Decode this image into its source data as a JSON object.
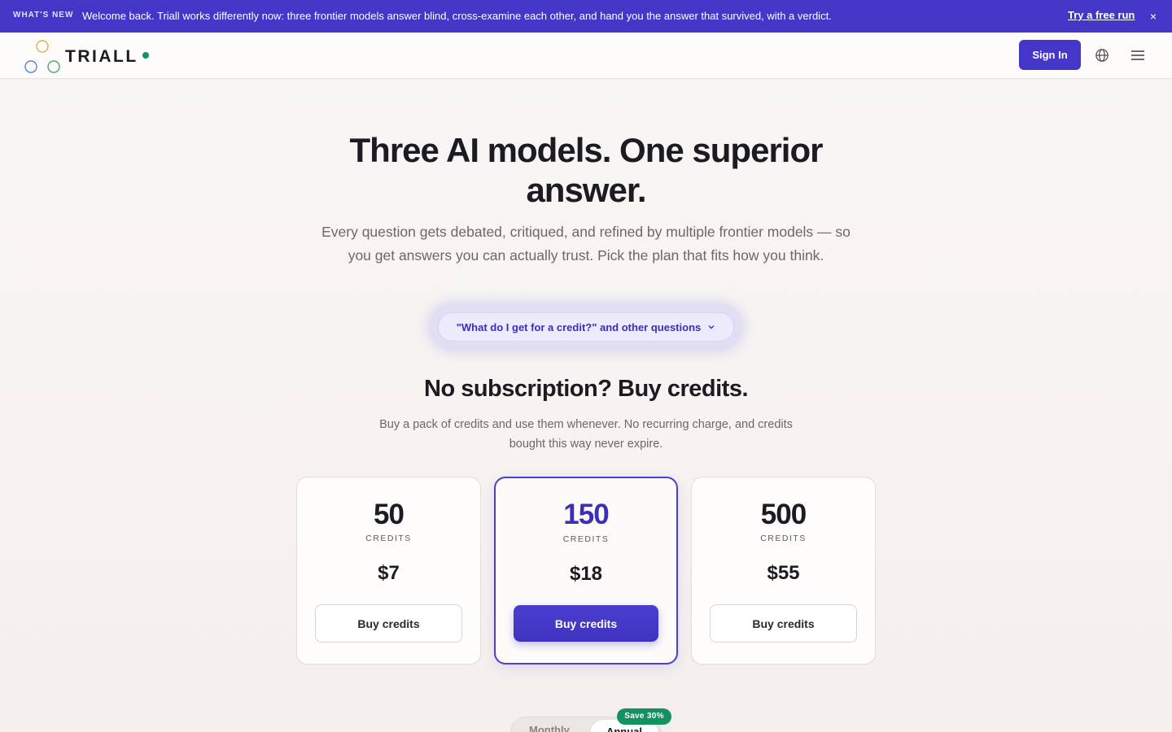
{
  "announcement": {
    "tag": "WHAT'S NEW",
    "message": "Welcome back. Triall works differently now: three frontier models answer blind, cross-examine each other, and hand you the answer that survived, with a verdict.",
    "cta": "Try a free run",
    "close": "×"
  },
  "nav": {
    "brand": "TRIALL",
    "sign_in": "Sign In",
    "icons": [
      "globe-icon",
      "menu-icon"
    ]
  },
  "hero": {
    "title": "Three AI models. One superior answer.",
    "subtitle": "Every question gets debated, critiqued, and refined by multiple frontier models — so you get answers you can actually trust. Pick the plan that fits how you think.",
    "faq_button": "\"What do I get for a credit?\" and other questions"
  },
  "credits": {
    "title": "No subscription? Buy credits.",
    "subtitle": "Buy a pack of credits and use them whenever. No recurring charge, and credits bought this way never expire.",
    "packs": [
      {
        "amount": "50",
        "unit": "CREDITS",
        "price": "$7",
        "button": "Buy credits",
        "featured": false
      },
      {
        "amount": "150",
        "unit": "CREDITS",
        "price": "$18",
        "button": "Buy credits",
        "featured": true
      },
      {
        "amount": "500",
        "unit": "CREDITS",
        "price": "$55",
        "button": "Buy credits",
        "featured": false
      }
    ]
  },
  "billing": {
    "monthly": "Monthly",
    "annual": "Annual",
    "save_badge": "Save 30%"
  },
  "colors": {
    "accent": "#4437c8",
    "success": "#13925f",
    "background": "#f8f6f4"
  }
}
